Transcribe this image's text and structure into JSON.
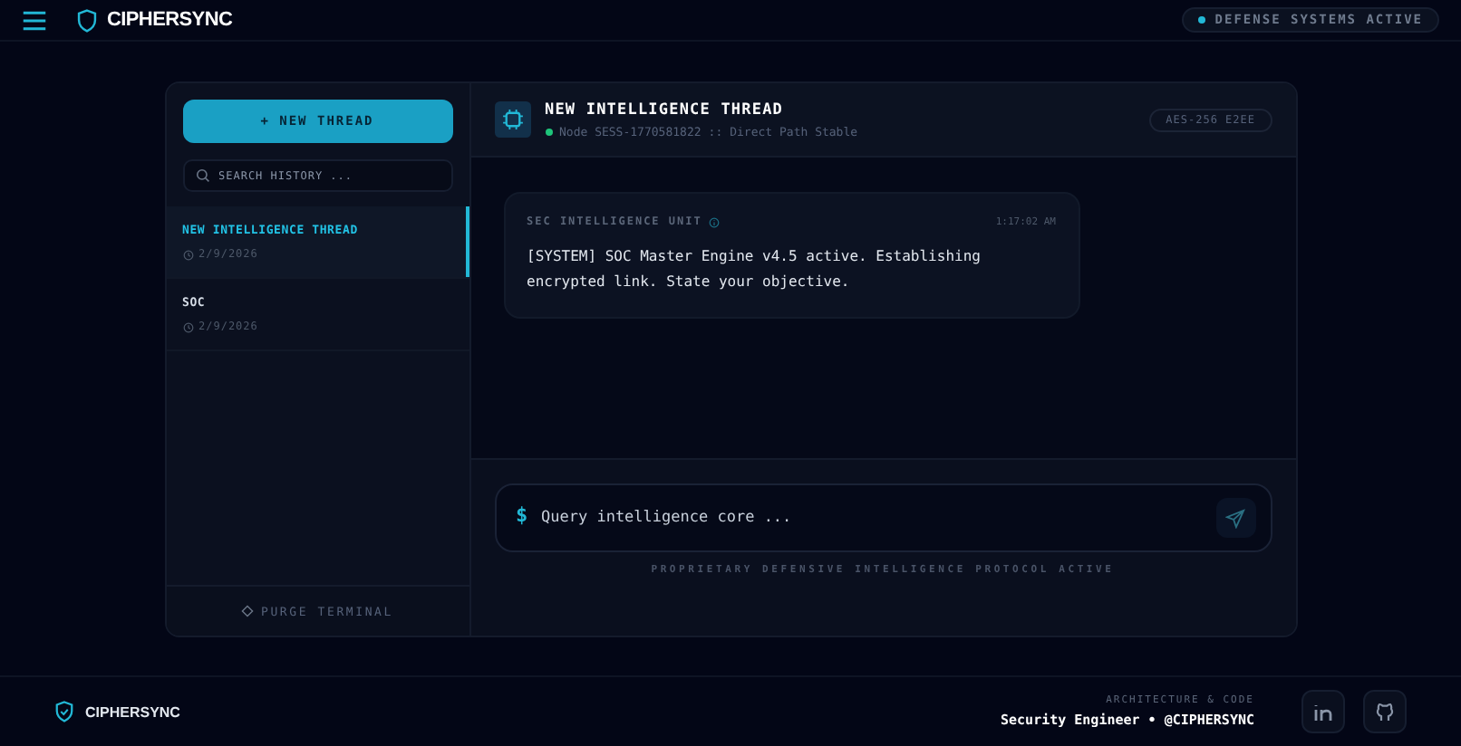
{
  "header": {
    "brand": "CIPHERSYNC",
    "status": "DEFENSE SYSTEMS ACTIVE"
  },
  "sidebar": {
    "new_thread": "+ NEW THREAD",
    "search": {
      "placeholder": "SEARCH HISTORY ..."
    },
    "threads": [
      {
        "title": "NEW INTELLIGENCE THREAD",
        "date": "2/9/2026",
        "selected": true
      },
      {
        "title": "SOC",
        "date": "2/9/2026",
        "selected": false
      }
    ],
    "purge": "PURGE TERMINAL"
  },
  "chat": {
    "title": "NEW INTELLIGENCE THREAD",
    "node": "Node SESS-1770581822",
    "separator": "::",
    "path": "Direct Path Stable",
    "encryption": "AES-256 E2EE",
    "messages": [
      {
        "sender": "SEC INTELLIGENCE UNIT",
        "time": "1:17:02 AM",
        "text": "[SYSTEM] SOC Master Engine v4.5 active. Establishing encrypted link. State your objective."
      }
    ],
    "input": {
      "prompt": "$",
      "placeholder": "Query intelligence core ..."
    },
    "footnote": "PROPRIETARY DEFENSIVE INTELLIGENCE PROTOCOL ACTIVE"
  },
  "footer": {
    "brand": "CIPHERSYNC",
    "credit_label": "ARCHITECTURE & CODE",
    "credit": "Security Engineer • @CIPHERSYNC"
  }
}
